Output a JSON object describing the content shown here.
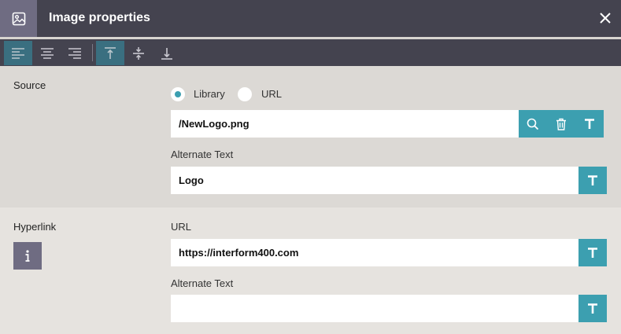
{
  "dialog": {
    "title": "Image properties"
  },
  "icons": {
    "header": "image-icon",
    "close": "close-icon",
    "info": "info-icon"
  },
  "toolbar": {
    "buttons": [
      {
        "name": "align-left",
        "active": true
      },
      {
        "name": "align-center",
        "active": false
      },
      {
        "name": "align-right",
        "active": false
      },
      {
        "name": "valign-top",
        "active": true
      },
      {
        "name": "valign-middle",
        "active": false
      },
      {
        "name": "valign-bottom",
        "active": false
      }
    ]
  },
  "source": {
    "label": "Source",
    "options": [
      {
        "label": "Library",
        "selected": true
      },
      {
        "label": "URL",
        "selected": false
      }
    ],
    "path_value": "/NewLogo.png",
    "alt_label": "Alternate Text",
    "alt_value": "Logo"
  },
  "hyperlink": {
    "label": "Hyperlink",
    "url_label": "URL",
    "url_value": "https://interform400.com",
    "alt_label": "Alternate Text",
    "alt_value": ""
  },
  "colors": {
    "header_bg": "#44434f",
    "accent": "#3c9fb0",
    "icon_bg": "#6f6c82",
    "source_bg": "#dcd9d5",
    "hyper_bg": "#e6e3df"
  }
}
